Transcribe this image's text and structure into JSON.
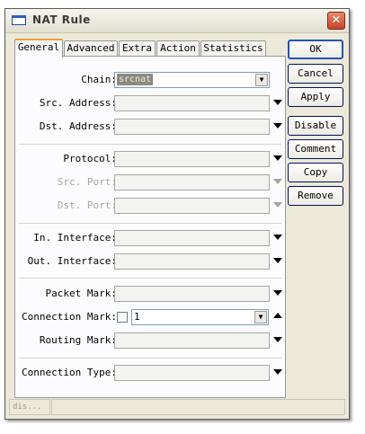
{
  "window": {
    "title": "NAT Rule",
    "close_glyph": "✕"
  },
  "tabs": [
    {
      "label": "General",
      "active": true
    },
    {
      "label": "Advanced"
    },
    {
      "label": "Extra"
    },
    {
      "label": "Action"
    },
    {
      "label": "Statistics"
    }
  ],
  "form": {
    "chain": {
      "label": "Chain:",
      "value": "srcnat"
    },
    "src_address": {
      "label": "Src. Address:",
      "value": ""
    },
    "dst_address": {
      "label": "Dst. Address:",
      "value": ""
    },
    "protocol": {
      "label": "Protocol:",
      "value": ""
    },
    "src_port": {
      "label": "Src. Port:",
      "value": "",
      "disabled": true
    },
    "dst_port": {
      "label": "Dst. Port:",
      "value": "",
      "disabled": true
    },
    "in_interface": {
      "label": "In. Interface:",
      "value": ""
    },
    "out_interface": {
      "label": "Out. Interface:",
      "value": ""
    },
    "packet_mark": {
      "label": "Packet Mark:",
      "value": ""
    },
    "connection_mark": {
      "label": "Connection Mark:",
      "value": "1",
      "negate_checked": false
    },
    "routing_mark": {
      "label": "Routing Mark:",
      "value": ""
    },
    "connection_type": {
      "label": "Connection Type:",
      "value": ""
    }
  },
  "buttons": {
    "ok": "OK",
    "cancel": "Cancel",
    "apply": "Apply",
    "disable": "Disable",
    "comment": "Comment",
    "copy": "Copy",
    "remove": "Remove"
  },
  "status": {
    "state": "dis..."
  },
  "icons": {
    "dropdown": "triangle-down-icon",
    "collapse": "triangle-up-icon",
    "combo": "combo-arrow-icon"
  }
}
